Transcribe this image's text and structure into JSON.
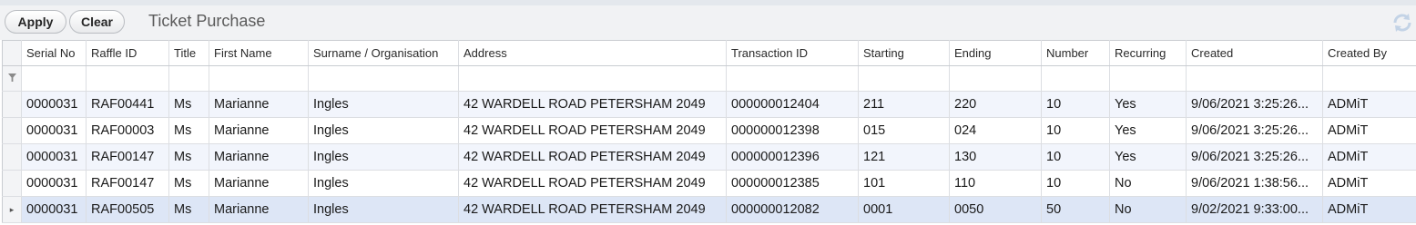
{
  "toolbar": {
    "apply_label": "Apply",
    "clear_label": "Clear",
    "title": "Ticket Purchase",
    "refresh_icon": "refresh-icon"
  },
  "grid": {
    "columns": [
      "Serial No",
      "Raffle ID",
      "Title",
      "First Name",
      "Surname / Organisation",
      "Address",
      "Transaction ID",
      "Starting",
      "Ending",
      "Number",
      "Recurring",
      "Created",
      "Created By"
    ],
    "filter_icon": "filter-icon",
    "current_row_icon": "row-pointer-icon",
    "rows": [
      [
        "0000031",
        "RAF00441",
        "Ms",
        "Marianne",
        "Ingles",
        "42 WARDELL ROAD PETERSHAM 2049",
        "000000012404",
        "211",
        "220",
        "10",
        "Yes",
        "9/06/2021 3:25:26...",
        "ADMiT"
      ],
      [
        "0000031",
        "RAF00003",
        "Ms",
        "Marianne",
        "Ingles",
        "42 WARDELL ROAD PETERSHAM 2049",
        "000000012398",
        "015",
        "024",
        "10",
        "Yes",
        "9/06/2021 3:25:26...",
        "ADMiT"
      ],
      [
        "0000031",
        "RAF00147",
        "Ms",
        "Marianne",
        "Ingles",
        "42 WARDELL ROAD PETERSHAM 2049",
        "000000012396",
        "121",
        "130",
        "10",
        "Yes",
        "9/06/2021 3:25:26...",
        "ADMiT"
      ],
      [
        "0000031",
        "RAF00147",
        "Ms",
        "Marianne",
        "Ingles",
        "42 WARDELL ROAD PETERSHAM 2049",
        "000000012385",
        "101",
        "110",
        "10",
        "No",
        "9/06/2021 1:38:56...",
        "ADMiT"
      ],
      [
        "0000031",
        "RAF00505",
        "Ms",
        "Marianne",
        "Ingles",
        "42 WARDELL ROAD PETERSHAM 2049",
        "000000012082",
        "0001",
        "0050",
        "50",
        "No",
        "9/02/2021 9:33:00...",
        "ADMiT"
      ]
    ],
    "selected_row": 4
  }
}
